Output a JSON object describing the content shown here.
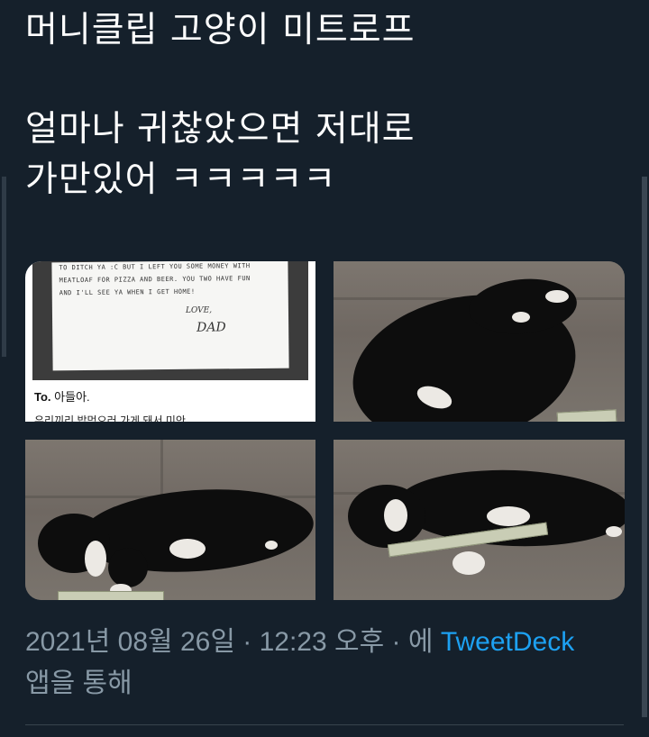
{
  "tweet": {
    "lines": [
      "머니클립 고양이 미트로프",
      "얼마나 귀찮았으면 저대로",
      "가만있어 ㅋㅋㅋㅋㅋ"
    ]
  },
  "media": {
    "note": {
      "handwriting": [
        "TO DITCH YA :C BUT I LEFT YOU SOME MONEY WITH",
        "MEATLOAF FOR PIZZA AND BEER. YOU TWO HAVE FUN",
        "AND I'LL SEE YA WHEN I GET HOME!"
      ],
      "closing": "LOVE,",
      "signature": "DAD",
      "caption_to": "To.",
      "caption_rest": "아들아.",
      "caption_cut": "우리끼리 밥먹으러 가게 돼서 미안"
    }
  },
  "meta": {
    "timestamp": "2021년 08월 26일 · 12:23 오후 · 에",
    "source": "TweetDeck",
    "suffix": "앱을 통해"
  },
  "colors": {
    "background": "#15202b",
    "link": "#1da1f2",
    "meta_text": "#8899a6"
  }
}
